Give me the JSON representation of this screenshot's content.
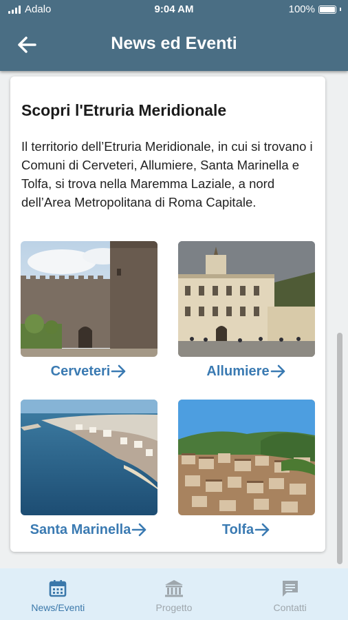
{
  "status_bar": {
    "carrier": "Adalo",
    "time": "9:04 AM",
    "battery": "100%"
  },
  "header": {
    "title": "News ed Eventi",
    "back_icon": "arrow-left-icon"
  },
  "card": {
    "title": "Scopri l'Etruria Meridionale",
    "text": "Il territorio dell’Etruria Meridionale, in cui si trovano i Comuni di Cerveteri, Allumiere, Santa Marinella e Tolfa, si trova nella Maremma Laziale, a nord dell’Area Metropolitana di Roma Capitale.",
    "places": [
      {
        "name": "Cerveteri",
        "icon": "arrow-right-icon"
      },
      {
        "name": "Allumiere",
        "icon": "arrow-right-icon"
      },
      {
        "name": "Santa Marinella",
        "icon": "arrow-right-icon"
      },
      {
        "name": "Tolfa",
        "icon": "arrow-right-icon"
      }
    ]
  },
  "bottom_nav": {
    "items": [
      {
        "label": "News/Eventi",
        "icon": "calendar-icon",
        "active": true
      },
      {
        "label": "Progetto",
        "icon": "bank-icon",
        "active": false
      },
      {
        "label": "Contatti",
        "icon": "chat-icon",
        "active": false
      }
    ]
  },
  "colors": {
    "header_bg": "#4a6e84",
    "link": "#3a7ab2",
    "nav_bg": "#dfeef8",
    "nav_active": "#3b78aa",
    "nav_inactive": "#9ea6ac"
  }
}
